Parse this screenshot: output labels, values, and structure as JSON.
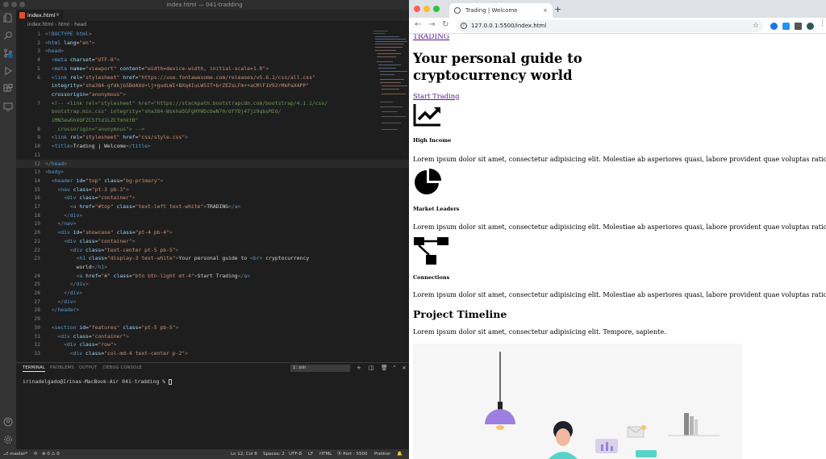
{
  "vscode": {
    "window_title": "index.html — 041-tradding",
    "tab_label": "index.html",
    "tab_close": "×",
    "breadcrumb": [
      "index.html",
      "html",
      "head"
    ],
    "code_lines": [
      {
        "n": "1",
        "html": "<span class=\"t-br\">&lt;</span><span class=\"t-tag\">!DOCTYPE html</span><span class=\"t-br\">&gt;</span>"
      },
      {
        "n": "2",
        "html": "<span class=\"t-br\">&lt;</span><span class=\"t-tag\">html</span> <span class=\"t-attr\">lang</span>=<span class=\"t-str\">\"en\"</span><span class=\"t-br\">&gt;</span>"
      },
      {
        "n": "3",
        "html": "<span class=\"t-br\">&lt;</span><span class=\"t-tag\">head</span><span class=\"t-br\">&gt;</span>"
      },
      {
        "n": "4",
        "html": "  <span class=\"t-br\">&lt;</span><span class=\"t-tag\">meta</span> <span class=\"t-attr\">charset</span>=<span class=\"t-str\">\"UTF-8\"</span><span class=\"t-br\">&gt;</span>"
      },
      {
        "n": "5",
        "html": "  <span class=\"t-br\">&lt;</span><span class=\"t-tag\">meta</span> <span class=\"t-attr\">name</span>=<span class=\"t-str\">\"viewport\"</span> <span class=\"t-attr\">content</span>=<span class=\"t-str\">\"width=device-width, initial-scale=1.0\"</span><span class=\"t-br\">&gt;</span>"
      },
      {
        "n": "6",
        "html": "  <span class=\"t-br\">&lt;</span><span class=\"t-tag\">link</span> <span class=\"t-attr\">rel</span>=<span class=\"t-str\">\"stylesheet\"</span> <span class=\"t-attr\">href</span>=<span class=\"t-str\">\"https://use.fontawesome.com/releases/v5.6.1/css/all.css\"</span>"
      },
      {
        "n": "",
        "html": "  <span class=\"t-attr\">integrity</span>=<span class=\"t-str\">\"sha384-gfdkjb5BdAXd+lj+gudLWI+BXq4IuLW5IT+brZEZsLFm++aCMlF1V92rMkPaX4PP\"</span>"
      },
      {
        "n": "",
        "html": "  <span class=\"t-attr\">crossorigin</span>=<span class=\"t-str\">\"anonymous\"</span><span class=\"t-br\">&gt;</span>"
      },
      {
        "n": "7",
        "html": "  <span class=\"t-com\">&lt;!-- &lt;link rel=\"stylesheet\" href=\"https://stackpath.bootstrapcdn.com/bootstrap/4.1.1/css/</span>"
      },
      {
        "n": "",
        "html": "  <span class=\"t-com\">bootstrap.min.css\" integrity=\"sha384-WskhaSGFgHYWDcbwN70/dfYDj47jz9qbsMId/</span>"
      },
      {
        "n": "",
        "html": "  <span class=\"t-com\">iMN3ewGhXQFZCSftd1LZCfmhktB\"</span>"
      },
      {
        "n": "8",
        "html": "    <span class=\"t-com\">crossorigin=\"anonymous\"&gt; --&gt;</span>"
      },
      {
        "n": "9",
        "html": "  <span class=\"t-br\">&lt;</span><span class=\"t-tag\">link</span> <span class=\"t-attr\">rel</span>=<span class=\"t-str\">\"stylesheet\"</span> <span class=\"t-attr\">href</span>=<span class=\"t-str\">\"css/style.css\"</span><span class=\"t-br\">&gt;</span>"
      },
      {
        "n": "10",
        "html": "  <span class=\"t-br\">&lt;</span><span class=\"t-tag\">title</span><span class=\"t-br\">&gt;</span>Trading | Welcome<span class=\"t-br\">&lt;/</span><span class=\"t-tag\">title</span><span class=\"t-br\">&gt;</span>"
      },
      {
        "n": "11",
        "html": ""
      },
      {
        "n": "12",
        "html": "<span class=\"t-br\">&lt;/</span><span class=\"t-tag\">head</span><span class=\"t-br\">&gt;</span>"
      },
      {
        "n": "13",
        "html": "<span class=\"t-br\">&lt;</span><span class=\"t-tag\">body</span><span class=\"t-br\">&gt;</span>"
      },
      {
        "n": "14",
        "html": "  <span class=\"t-br\">&lt;</span><span class=\"t-tag\">header</span> <span class=\"t-attr\">id</span>=<span class=\"t-str\">\"top\"</span> <span class=\"t-attr\">class</span>=<span class=\"t-str\">\"bg-primary\"</span><span class=\"t-br\">&gt;</span>"
      },
      {
        "n": "15",
        "html": "    <span class=\"t-br\">&lt;</span><span class=\"t-tag\">nav</span> <span class=\"t-attr\">class</span>=<span class=\"t-str\">\"pt-3 pb-3\"</span><span class=\"t-br\">&gt;</span>"
      },
      {
        "n": "16",
        "html": "      <span class=\"t-br\">&lt;</span><span class=\"t-tag\">div</span> <span class=\"t-attr\">class</span>=<span class=\"t-str\">\"container\"</span><span class=\"t-br\">&gt;</span>"
      },
      {
        "n": "17",
        "html": "        <span class=\"t-br\">&lt;</span><span class=\"t-tag\">a</span> <span class=\"t-attr\">href</span>=<span class=\"t-str\">\"#top\"</span> <span class=\"t-attr\">class</span>=<span class=\"t-str\">\"text-left text-white\"</span><span class=\"t-br\">&gt;</span>TRADING<span class=\"t-br\">&lt;/</span><span class=\"t-tag\">a</span><span class=\"t-br\">&gt;</span>"
      },
      {
        "n": "18",
        "html": "      <span class=\"t-br\">&lt;/</span><span class=\"t-tag\">div</span><span class=\"t-br\">&gt;</span>"
      },
      {
        "n": "19",
        "html": "    <span class=\"t-br\">&lt;/</span><span class=\"t-tag\">nav</span><span class=\"t-br\">&gt;</span>"
      },
      {
        "n": "20",
        "html": "    <span class=\"t-br\">&lt;</span><span class=\"t-tag\">div</span> <span class=\"t-attr\">id</span>=<span class=\"t-str\">\"showcase\"</span> <span class=\"t-attr\">class</span>=<span class=\"t-str\">\"pt-4 pb-4\"</span><span class=\"t-br\">&gt;</span>"
      },
      {
        "n": "21",
        "html": "      <span class=\"t-br\">&lt;</span><span class=\"t-tag\">div</span> <span class=\"t-attr\">class</span>=<span class=\"t-str\">\"container\"</span><span class=\"t-br\">&gt;</span>"
      },
      {
        "n": "22",
        "html": "        <span class=\"t-br\">&lt;</span><span class=\"t-tag\">div</span> <span class=\"t-attr\">class</span>=<span class=\"t-str\">\"text-center pt-5 pb-5\"</span><span class=\"t-br\">&gt;</span>"
      },
      {
        "n": "23",
        "html": "          <span class=\"t-br\">&lt;</span><span class=\"t-tag\">h1</span> <span class=\"t-attr\">class</span>=<span class=\"t-str\">\"display-3 text-white\"</span><span class=\"t-br\">&gt;</span>Your personal guide to <span class=\"t-br\">&lt;</span><span class=\"t-tag\">br</span><span class=\"t-br\">&gt;</span> cryptocurrency"
      },
      {
        "n": "",
        "html": "          world<span class=\"t-br\">&lt;/</span><span class=\"t-tag\">h1</span><span class=\"t-br\">&gt;</span>"
      },
      {
        "n": "24",
        "html": "          <span class=\"t-br\">&lt;</span><span class=\"t-tag\">a</span> <span class=\"t-attr\">href</span>=<span class=\"t-str\">\"#\"</span> <span class=\"t-attr\">class</span>=<span class=\"t-str\">\"btn btn-light mt-4\"</span><span class=\"t-br\">&gt;</span>Start Trading<span class=\"t-br\">&lt;/</span><span class=\"t-tag\">a</span><span class=\"t-br\">&gt;</span>"
      },
      {
        "n": "25",
        "html": "        <span class=\"t-br\">&lt;/</span><span class=\"t-tag\">div</span><span class=\"t-br\">&gt;</span>"
      },
      {
        "n": "26",
        "html": "      <span class=\"t-br\">&lt;/</span><span class=\"t-tag\">div</span><span class=\"t-br\">&gt;</span>"
      },
      {
        "n": "27",
        "html": "    <span class=\"t-br\">&lt;/</span><span class=\"t-tag\">div</span><span class=\"t-br\">&gt;</span>"
      },
      {
        "n": "28",
        "html": "  <span class=\"t-br\">&lt;/</span><span class=\"t-tag\">header</span><span class=\"t-br\">&gt;</span>"
      },
      {
        "n": "29",
        "html": ""
      },
      {
        "n": "30",
        "html": "  <span class=\"t-br\">&lt;</span><span class=\"t-tag\">section</span> <span class=\"t-attr\">id</span>=<span class=\"t-str\">\"features\"</span> <span class=\"t-attr\">class</span>=<span class=\"t-str\">\"pt-5 pb-5\"</span><span class=\"t-br\">&gt;</span>"
      },
      {
        "n": "31",
        "html": "    <span class=\"t-br\">&lt;</span><span class=\"t-tag\">div</span> <span class=\"t-attr\">class</span>=<span class=\"t-str\">\"container\"</span><span class=\"t-br\">&gt;</span>"
      },
      {
        "n": "32",
        "html": "      <span class=\"t-br\">&lt;</span><span class=\"t-tag\">div</span> <span class=\"t-attr\">class</span>=<span class=\"t-str\">\"row\"</span><span class=\"t-br\">&gt;</span>"
      },
      {
        "n": "33",
        "html": "        <span class=\"t-br\">&lt;</span><span class=\"t-tag\">div</span> <span class=\"t-attr\">class</span>=<span class=\"t-str\">\"col-md-4 text-center p-2\"</span><span class=\"t-br\">&gt;</span>"
      }
    ],
    "panel_tabs": [
      "TERMINAL",
      "PROBLEMS",
      "OUTPUT",
      "DEBUG CONSOLE"
    ],
    "terminal_select": "1: zsh",
    "terminal_prompt": "irinadelgado@Irinas-MacBook-Air 041-tradding % ",
    "status": {
      "branch": "master*",
      "errors": "0",
      "warnings": "0",
      "position": "Ln 12, Col 8",
      "spaces": "Spaces: 2",
      "encoding": "UTF-8",
      "eol": "LF",
      "language": "HTML",
      "port": "Port : 5500",
      "formatter": "Prettier"
    }
  },
  "browser": {
    "tab_title": "Trading | Welcome",
    "tab_close": "×",
    "new_tab": "+",
    "url": "127.0.0.1:5500/index.html",
    "colors": {
      "close": "#ff5f57",
      "minimize": "#febc2e",
      "maximize": "#28c840"
    },
    "page": {
      "brand": "TRADING",
      "headline_line1": "Your personal guide to",
      "headline_line2": "cryptocurrency world",
      "cta": "Start Trading",
      "features": [
        {
          "icon": "chart-line-icon",
          "title": "High Income",
          "text": "Lorem ipsum dolor sit amet, consectetur adipisicing elit. Molestiae ab asperiores quasi, labore provident quae voluptas ratione cum qui culpa?"
        },
        {
          "icon": "chart-pie-icon",
          "title": "Market Leaders",
          "text": "Lorem ipsum dolor sit amet, consectetur adipisicing elit. Molestiae ab asperiores quasi, labore provident quae voluptas ratione cum qui culpa?"
        },
        {
          "icon": "project-diagram-icon",
          "title": "Connections",
          "text": "Lorem ipsum dolor sit amet, consectetur adipisicing elit. Molestiae ab asperiores quasi, labore provident quae voluptas ratione cum qui culpa?"
        }
      ],
      "timeline_title": "Project Timeline",
      "timeline_text": "Lorem ipsum dolor sit amet, consectetur adipisicing elit. Tempore, sapiente."
    }
  }
}
